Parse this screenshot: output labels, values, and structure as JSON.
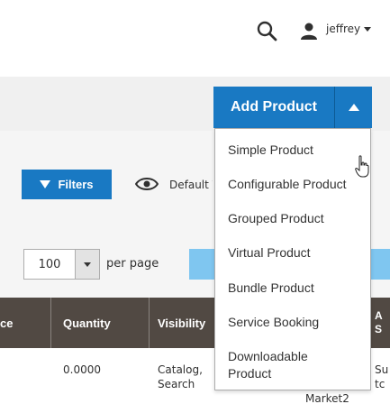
{
  "header": {
    "username": "jeffrey"
  },
  "actions": {
    "add_product_label": "Add Product",
    "dropdown_items": [
      {
        "label": "Simple Product"
      },
      {
        "label": "Configurable Product"
      },
      {
        "label": "Grouped Product"
      },
      {
        "label": "Virtual Product"
      },
      {
        "label": "Bundle Product"
      },
      {
        "label": "Service Booking"
      },
      {
        "label": "Downloadable Product"
      }
    ]
  },
  "toolbar": {
    "filters_label": "Filters",
    "default_view_label": "Default View"
  },
  "pagination": {
    "per_page_value": "100",
    "per_page_label": "per page"
  },
  "table": {
    "columns": [
      "ce",
      "Quantity",
      "Visibility",
      "A S"
    ],
    "row": {
      "quantity": "0.0000",
      "visibility_line1": "Catalog,",
      "visibility_line2": "Search",
      "website_fragment": "Market2",
      "store_fragment_1": "Su",
      "store_fragment_2": "tc"
    }
  },
  "colors": {
    "primary": "#1979c3",
    "table_header": "#514943",
    "pager_disabled": "#7fc6f0"
  }
}
